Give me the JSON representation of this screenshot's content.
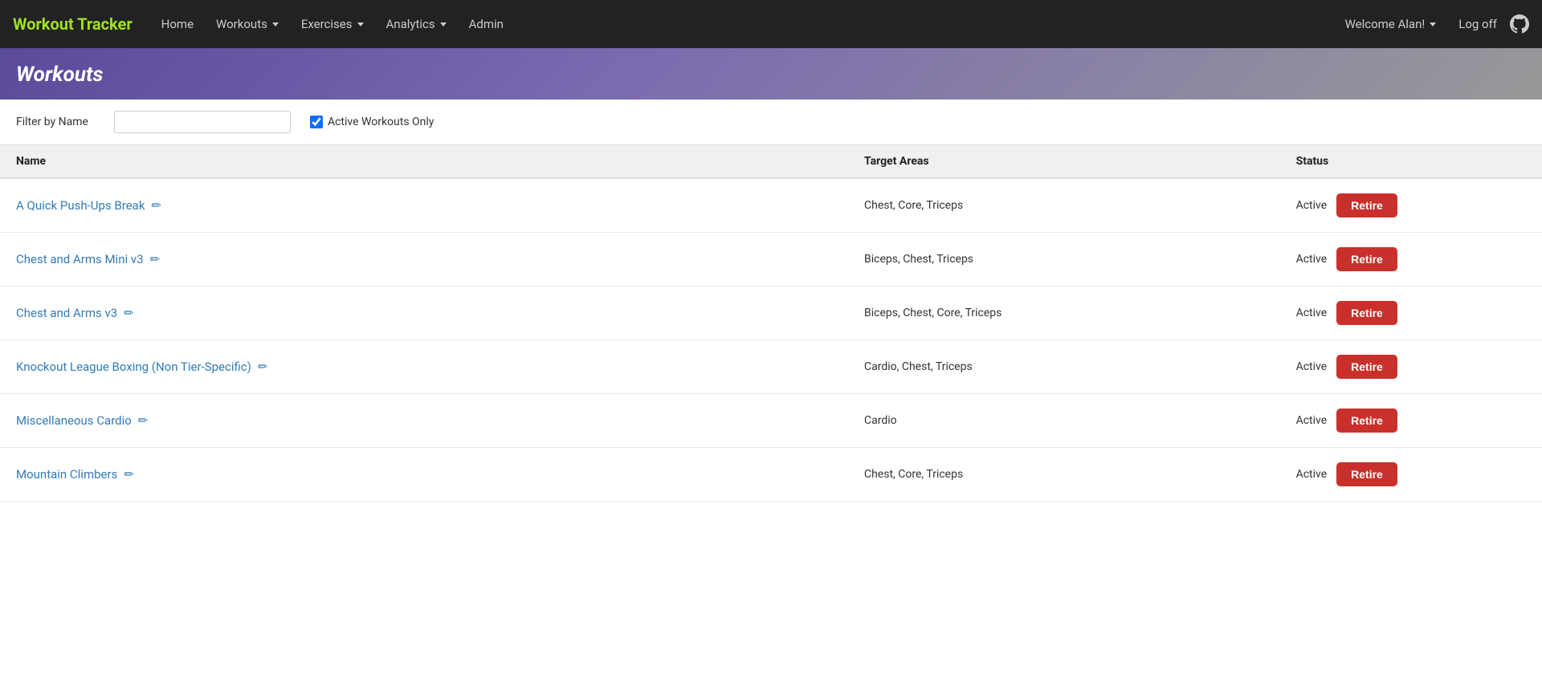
{
  "navbar": {
    "brand": "Workout Tracker",
    "nav_items": [
      {
        "label": "Home",
        "has_dropdown": false
      },
      {
        "label": "Workouts",
        "has_dropdown": true
      },
      {
        "label": "Exercises",
        "has_dropdown": true
      },
      {
        "label": "Analytics",
        "has_dropdown": true
      },
      {
        "label": "Admin",
        "has_dropdown": false
      }
    ],
    "welcome": "Welcome Alan!",
    "logoff": "Log off"
  },
  "page": {
    "title": "Workouts"
  },
  "filter": {
    "label": "Filter by Name",
    "placeholder": "",
    "active_label": "Active Workouts Only",
    "active_checked": true
  },
  "table": {
    "columns": [
      "Name",
      "Target Areas",
      "Status"
    ],
    "rows": [
      {
        "name": "A Quick Push-Ups Break",
        "target_areas": "Chest, Core, Triceps",
        "status": "Active",
        "retire_label": "Retire"
      },
      {
        "name": "Chest and Arms Mini v3",
        "target_areas": "Biceps, Chest, Triceps",
        "status": "Active",
        "retire_label": "Retire"
      },
      {
        "name": "Chest and Arms v3",
        "target_areas": "Biceps, Chest, Core, Triceps",
        "status": "Active",
        "retire_label": "Retire"
      },
      {
        "name": "Knockout League Boxing (Non Tier-Specific)",
        "target_areas": "Cardio, Chest, Triceps",
        "status": "Active",
        "retire_label": "Retire"
      },
      {
        "name": "Miscellaneous Cardio",
        "target_areas": "Cardio",
        "status": "Active",
        "retire_label": "Retire"
      },
      {
        "name": "Mountain Climbers",
        "target_areas": "Chest, Core, Triceps",
        "status": "Active",
        "retire_label": "Retire"
      }
    ]
  }
}
